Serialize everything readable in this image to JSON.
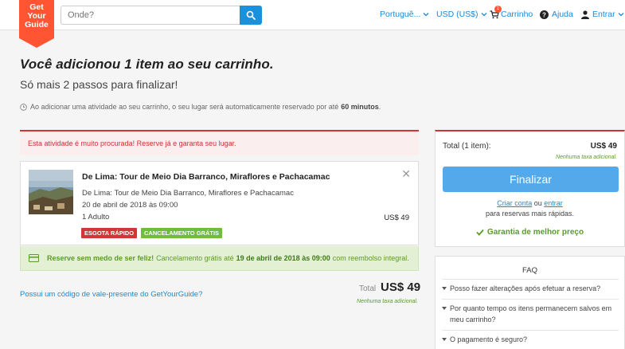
{
  "header": {
    "logo_lines": [
      "Get",
      "Your",
      "Guide"
    ],
    "search_placeholder": "Onde?",
    "language": "Portuguê...",
    "currency": "USD (US$)",
    "cart_label": "Carrinho",
    "cart_count": "1",
    "help_label": "Ajuda",
    "login_label": "Entrar"
  },
  "page": {
    "title": "Você adicionou 1 item ao seu carrinho.",
    "subtitle": "Só mais 2 passos para finalizar!",
    "reservation_notice": "Ao adicionar uma atividade ao seu carrinho, o seu lugar será automaticamente reservado por até",
    "reservation_time": "60 minutos",
    "reservation_end": "."
  },
  "alert": {
    "text": "Esta atividade é muito procurada! Reserve já e garanta seu lugar."
  },
  "cart_item": {
    "title": "De Lima: Tour de Meio Dia Barranco, Miraflores e Pachacamac",
    "subtitle": "De Lima: Tour de Meio Dia Barranco, Miraflores e Pachacamac",
    "date": "20 de abril de 2018 às 09:00",
    "participants": "1 Adulto",
    "price": "US$ 49",
    "tags": [
      "ESGOTA RÁPIDO",
      "CANCELAMENTO GRÁTIS"
    ]
  },
  "promo": {
    "bold": "Reserve sem medo de ser feliz!",
    "text": "Cancelamento grátis até",
    "date": "19 de abril de 2018 às 09:00",
    "end": "com reembolso integral."
  },
  "footer": {
    "voucher_link": "Possui um código de vale-presente do GetYourGuide?",
    "total_label": "Total",
    "total_value": "US$ 49",
    "no_tax": "Nenhuma taxa adicional."
  },
  "summary": {
    "label": "Total (1 item):",
    "value": "US$ 49",
    "no_tax": "Nenhuma taxa adicional.",
    "finalize_button": "Finalizar",
    "create_account": "Criar conta",
    "or": "ou",
    "login": "entrar",
    "faster": "para reservas mais rápidas.",
    "guarantee": "Garantia de melhor preço"
  },
  "faq": {
    "title": "FAQ",
    "items": [
      "Posso fazer alterações após efetuar a reserva?",
      "Por quanto tempo os itens permanecem salvos em meu carrinho?",
      "O pagamento é seguro?"
    ]
  },
  "colors": {
    "brand_red": "#ff5533",
    "link_blue": "#1a8ad8",
    "button_blue": "#53a9ea",
    "success_green": "#5b9a2c",
    "alert_red": "#d03435"
  }
}
